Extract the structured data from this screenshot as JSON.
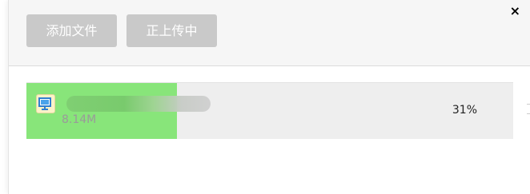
{
  "toolbar": {
    "add_files_label": "添加文件",
    "stop_upload_label": "正上传中"
  },
  "close": {
    "icon": "close-icon",
    "glyph": "×"
  },
  "files": [
    {
      "icon": "monitor-file-icon",
      "name": "",
      "size": "8.14M",
      "progress_percent": 31,
      "progress_label": "31%"
    }
  ],
  "colors": {
    "header_bg": "#f6f6f6",
    "button_bg": "#c9c9c9",
    "progress_fill": "#88e57a",
    "row_bg": "#eeeeee"
  }
}
